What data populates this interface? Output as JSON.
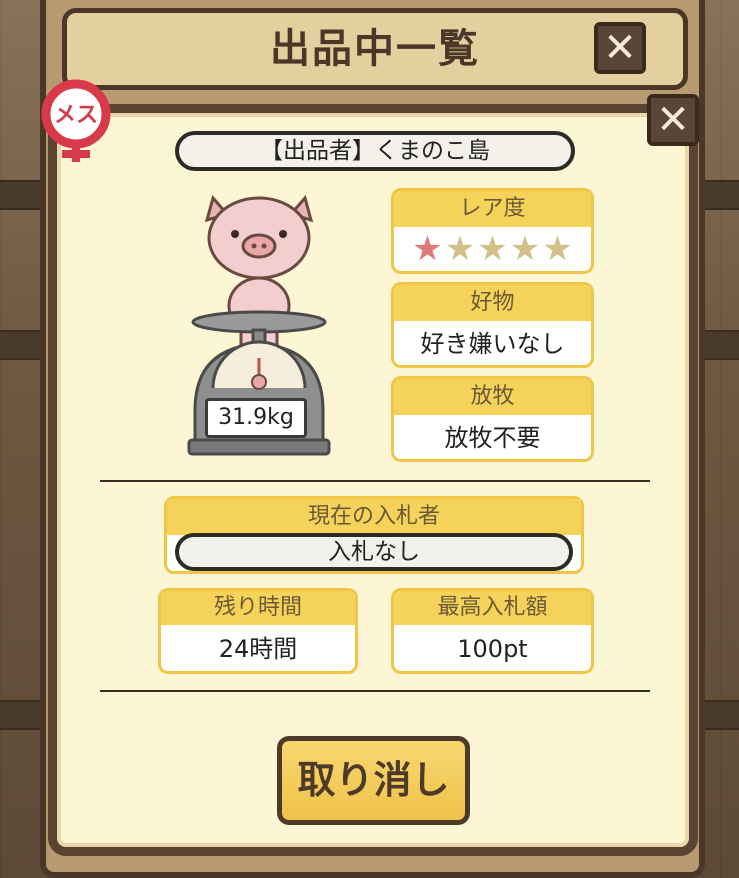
{
  "window": {
    "title": "出品中一覧",
    "close_label": "✕"
  },
  "dialog": {
    "close_label": "✕",
    "gender_badge": "メス",
    "seller": "【出品者】くまのこ島",
    "weight": "31.9kg",
    "rarity": {
      "label": "レア度",
      "rating": 1,
      "max": 5
    },
    "favorite": {
      "label": "好物",
      "value": "好き嫌いなし"
    },
    "grazing": {
      "label": "放牧",
      "value": "放牧不要"
    },
    "bidder": {
      "label": "現在の入札者",
      "value": "入札なし"
    },
    "remaining": {
      "label": "残り時間",
      "value": "24時間"
    },
    "highest_bid": {
      "label": "最高入札額",
      "value": "100pt"
    },
    "cancel_label": "取り消し"
  },
  "colors": {
    "panel_bg": "#fcf6d4",
    "header_yellow": "#f5d25a",
    "star_on": "#e07a7a",
    "star_off": "#d2c089",
    "badge_red": "#d93a4a",
    "frame_brown": "#5b4332"
  }
}
